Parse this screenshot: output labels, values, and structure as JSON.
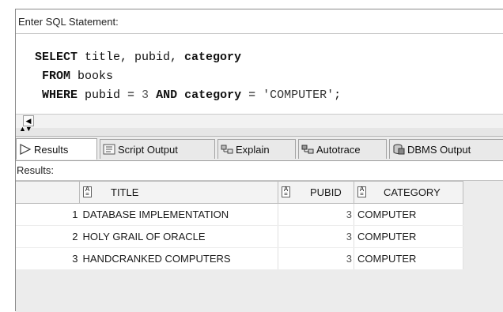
{
  "editor": {
    "prompt": "Enter SQL Statement:",
    "line1_kw": "SELECT",
    "line1_rest": " title, pubid, ",
    "line1_kw2": "category",
    "line2_kw": "FROM",
    "line2_rest": " books",
    "line3_kw": "WHERE",
    "line3_a": " pubid = ",
    "line3_num": "3",
    "line3_b": " ",
    "line3_kw2": "AND",
    "line3_c": " ",
    "line3_kw3": "category",
    "line3_d": " = ",
    "line3_str": "'COMPUTER'",
    "line3_e": ";"
  },
  "tabs": [
    {
      "label": "Results",
      "icon": "play-icon"
    },
    {
      "label": "Script Output",
      "icon": "script-icon"
    },
    {
      "label": "Explain",
      "icon": "explain-icon"
    },
    {
      "label": "Autotrace",
      "icon": "autotrace-icon"
    },
    {
      "label": "DBMS Output",
      "icon": "dbms-output-icon"
    }
  ],
  "results_label": "Results:",
  "grid": {
    "columns": [
      "TITLE",
      "PUBID",
      "CATEGORY"
    ],
    "rows": [
      {
        "n": "1",
        "title": "DATABASE IMPLEMENTATION",
        "pubid": "3",
        "category": "COMPUTER"
      },
      {
        "n": "2",
        "title": "HOLY GRAIL OF ORACLE",
        "pubid": "3",
        "category": "COMPUTER"
      },
      {
        "n": "3",
        "title": "HANDCRANKED COMPUTERS",
        "pubid": "3",
        "category": "COMPUTER"
      }
    ]
  },
  "colors": {
    "accent": "#2a6fc9",
    "tab_bg": "#e9e9e9",
    "grid_bg": "#ececec"
  }
}
